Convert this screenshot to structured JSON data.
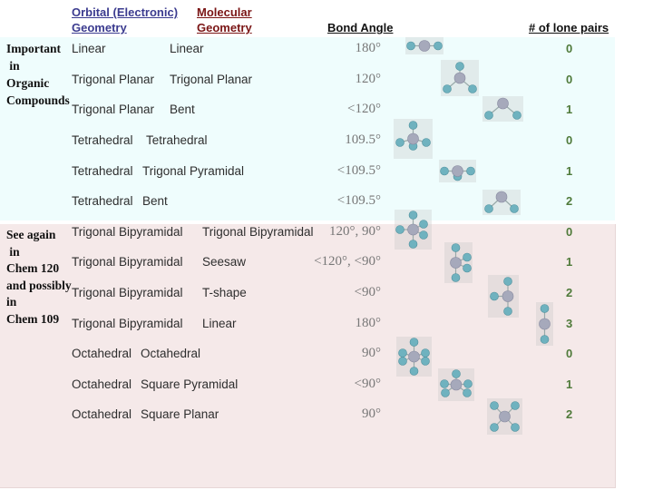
{
  "headers": {
    "orbital_line1": "Orbital (Electronic)",
    "orbital_line2": "Geometry",
    "molecular_line1": "Molecular",
    "molecular_line2": "Geometry",
    "bond_angle": "Bond Angle",
    "lone_pairs": "# of lone pairs"
  },
  "colors": {
    "orbital_header": "#3b3b8f",
    "molecular_header": "#7a1515",
    "lone_pair_text": "#4f7a3a",
    "organic_band": "#effdfd",
    "advanced_band": "#f5e9e9"
  },
  "groups": [
    {
      "label": "Important\n in\nOrganic\nCompounds"
    },
    {
      "label": "See again\n in\nChem 120\nand possibly\nin\nChem 109"
    }
  ],
  "rows": [
    {
      "orbital": "Linear",
      "molecular": "Linear",
      "angle": "180°",
      "lone_pairs": "0",
      "icon": "linear-molecule-icon"
    },
    {
      "orbital": "Trigonal Planar",
      "molecular": "Trigonal Planar",
      "angle": "120°",
      "lone_pairs": "0",
      "icon": "trigonal-planar-molecule-icon"
    },
    {
      "orbital": "Trigonal Planar",
      "molecular": "Bent",
      "angle": "<120°",
      "lone_pairs": "1",
      "icon": "bent-molecule-icon"
    },
    {
      "orbital": "Tetrahedral",
      "molecular": "Tetrahedral",
      "angle": "109.5°",
      "lone_pairs": "0",
      "icon": "tetrahedral-molecule-icon"
    },
    {
      "orbital": "Tetrahedral",
      "molecular": "Trigonal Pyramidal",
      "angle": "<109.5°",
      "lone_pairs": "1",
      "icon": "trigonal-pyramidal-molecule-icon"
    },
    {
      "orbital": "Tetrahedral",
      "molecular": "Bent",
      "angle": "<109.5°",
      "lone_pairs": "2",
      "icon": "bent-molecule-icon"
    },
    {
      "orbital": "Trigonal Bipyramidal",
      "molecular": "Trigonal Bipyramidal",
      "angle": "120°, 90°",
      "lone_pairs": "0",
      "icon": "trigonal-bipyramidal-molecule-icon"
    },
    {
      "orbital": "Trigonal Bipyramidal",
      "molecular": "Seesaw",
      "angle": "<120°, <90°",
      "lone_pairs": "1",
      "icon": "seesaw-molecule-icon"
    },
    {
      "orbital": "Trigonal Bipyramidal",
      "molecular": "T-shape",
      "angle": "<90°",
      "lone_pairs": "2",
      "icon": "t-shape-molecule-icon"
    },
    {
      "orbital": "Trigonal Bipyramidal",
      "molecular": "Linear",
      "angle": "180°",
      "lone_pairs": "3",
      "icon": "linear-molecule-icon"
    },
    {
      "orbital": "Octahedral",
      "molecular": "Octahedral",
      "angle": "90°",
      "lone_pairs": "0",
      "icon": "octahedral-molecule-icon"
    },
    {
      "orbital": "Octahedral",
      "molecular": "Square Pyramidal",
      "angle": "<90°",
      "lone_pairs": "1",
      "icon": "square-pyramidal-molecule-icon"
    },
    {
      "orbital": "Octahedral",
      "molecular": "Square Planar",
      "angle": "90°",
      "lone_pairs": "2",
      "icon": "square-planar-molecule-icon"
    }
  ]
}
